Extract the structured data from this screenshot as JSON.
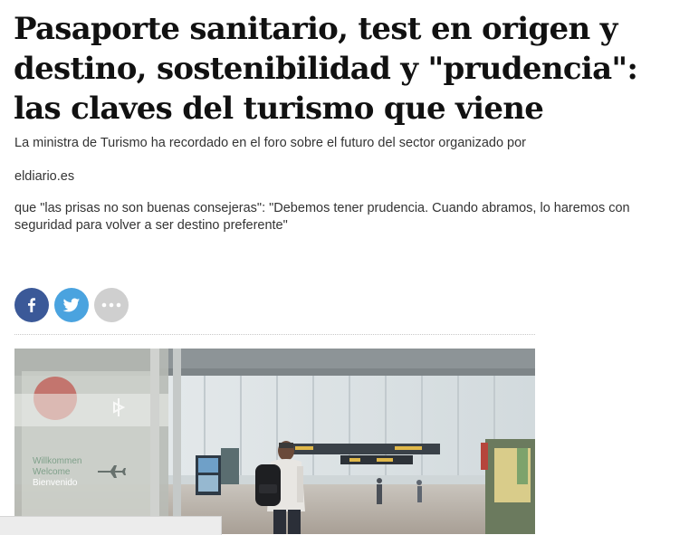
{
  "article": {
    "headline": "Pasaporte sanitario, test en origen y destino, sostenibilidad y \"prudencia\": las claves del turismo que viene",
    "summary_part1": "La ministra de Turismo ha recordado en el foro sobre el futuro del sector organizado por",
    "summary_source": "eldiario.es",
    "summary_part2": "que \"las prisas no son buenas consejeras\": \"Debemos tener prudencia. Cuando abramos, lo haremos con seguridad para volver a ser destino preferente\""
  },
  "share": {
    "icons": [
      "facebook-icon",
      "twitter-icon",
      "more-options-icon"
    ],
    "colors": {
      "facebook": "#3b5998",
      "twitter": "#4aa3df",
      "more": "#cfcfcf"
    }
  },
  "photo": {
    "sign_lines": [
      "Willkommen",
      "Welcome",
      "Bienvenido"
    ]
  }
}
